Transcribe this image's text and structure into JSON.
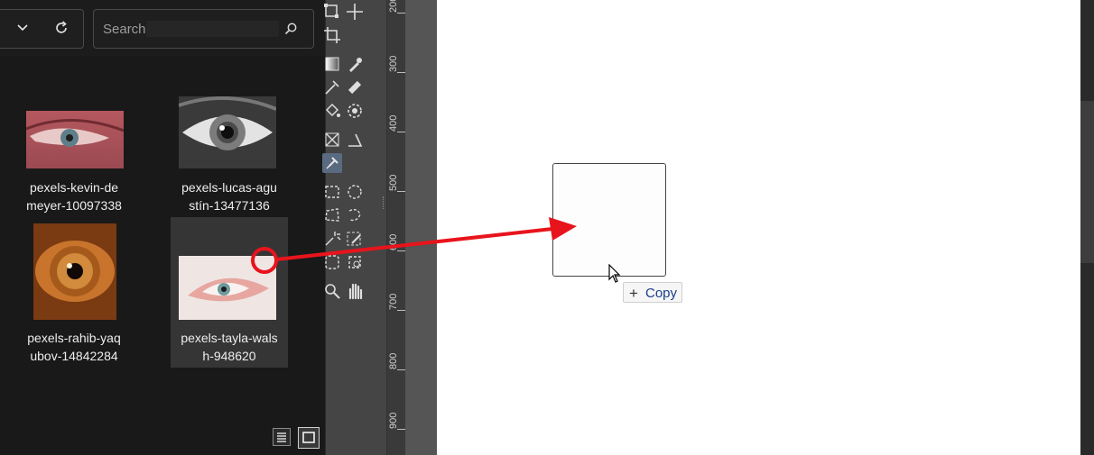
{
  "explorer": {
    "search_placeholder": "Search",
    "files": [
      {
        "label_line1": "pexels-kevin-de",
        "label_line2": "meyer-10097338"
      },
      {
        "label_line1": "pexels-lucas-agu",
        "label_line2": "stín-13477136"
      },
      {
        "label_line1": "pexels-rahib-yaq",
        "label_line2": "ubov-14842284"
      },
      {
        "label_line1": "pexels-tayla-wals",
        "label_line2": "h-948620"
      }
    ]
  },
  "ruler": {
    "labels": [
      "200",
      "300",
      "400",
      "500",
      "600",
      "700",
      "800",
      "900"
    ]
  },
  "drag": {
    "copy_label": "Copy",
    "copy_symbol": "+"
  },
  "colors": {
    "annotation_red": "#e8141c",
    "explorer_bg": "#191919",
    "toolbox_bg": "#454545",
    "canvas_bg": "#ffffff"
  },
  "icons": [
    "chevron-down-icon",
    "refresh-icon",
    "search-icon",
    "list-view-icon",
    "grid-view-icon"
  ]
}
